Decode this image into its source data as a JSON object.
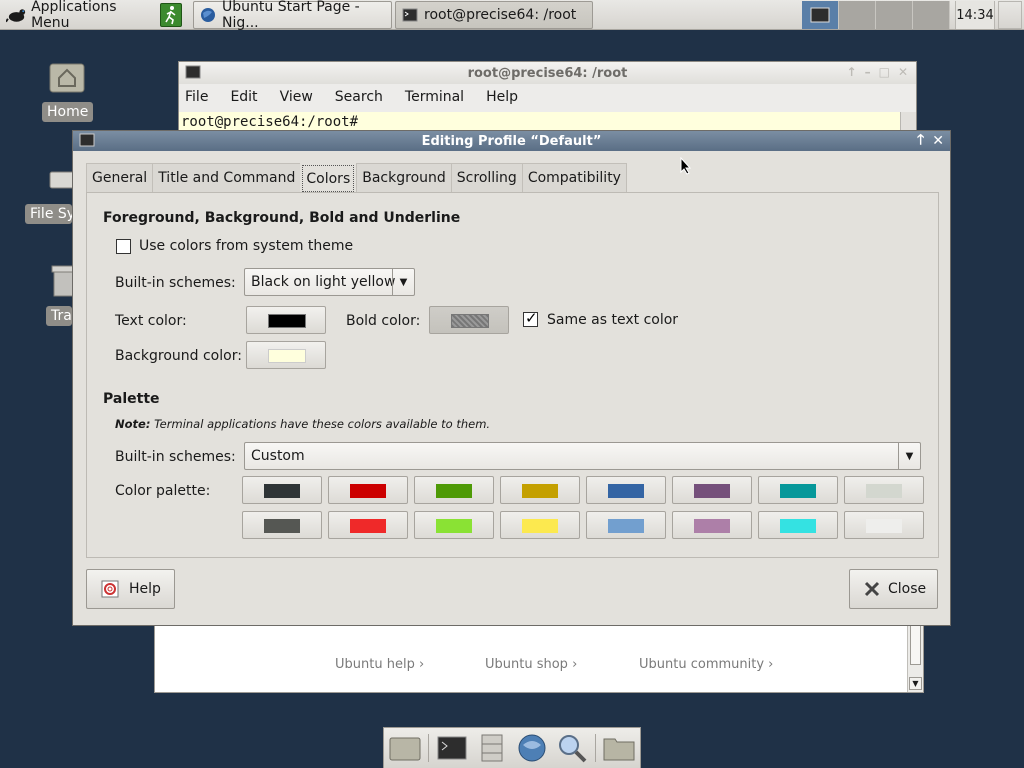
{
  "top_panel": {
    "apps_menu_label": "Applications Menu",
    "tasks": [
      {
        "label": "Ubuntu Start Page - Nig...",
        "icon": "browser-icon"
      },
      {
        "label": "root@precise64: /root",
        "icon": "terminal-icon"
      }
    ],
    "clock": "14:34"
  },
  "desktop": {
    "icons": [
      {
        "label": "Home",
        "icon": "home-folder-icon"
      },
      {
        "label": "File Sys",
        "icon": "filesystem-icon"
      },
      {
        "label": "Tras",
        "icon": "trash-icon"
      }
    ]
  },
  "terminal": {
    "title": "root@precise64: /root",
    "menu": [
      "File",
      "Edit",
      "View",
      "Search",
      "Terminal",
      "Help"
    ],
    "prompt": "root@precise64:/root#"
  },
  "browser": {
    "links": [
      "Ubuntu help ›",
      "Ubuntu shop ›",
      "Ubuntu community ›"
    ]
  },
  "dialog": {
    "title": "Editing Profile “Default”",
    "tabs": [
      "General",
      "Title and Command",
      "Colors",
      "Background",
      "Scrolling",
      "Compatibility"
    ],
    "active_tab": "Colors",
    "section_fg": "Foreground, Background, Bold and Underline",
    "use_system_colors_label": "Use colors from system theme",
    "use_system_colors_checked": false,
    "builtin_schemes_label": "Built-in schemes:",
    "builtin_scheme_value": "Black on light yellow",
    "text_color_label": "Text color:",
    "text_color": "#000000",
    "bold_color_label": "Bold color:",
    "same_as_text_label": "Same as text color",
    "same_as_text_checked": true,
    "bg_color_label": "Background color:",
    "bg_color": "#ffffdd",
    "palette_section": "Palette",
    "note_bold": "Note:",
    "note_text": "Terminal applications have these colors available to them.",
    "palette_schemes_label": "Built-in schemes:",
    "palette_scheme_value": "Custom",
    "color_palette_label": "Color palette:",
    "palette": [
      [
        "#2e3436",
        "#cc0000",
        "#4e9a06",
        "#c4a000",
        "#3465a4",
        "#75507b",
        "#06989a",
        "#d3d7cf"
      ],
      [
        "#555753",
        "#ef2929",
        "#8ae234",
        "#fce94f",
        "#729fcf",
        "#ad7fa8",
        "#34e2e2",
        "#eeeeec"
      ]
    ],
    "help_label": "Help",
    "close_label": "Close"
  }
}
